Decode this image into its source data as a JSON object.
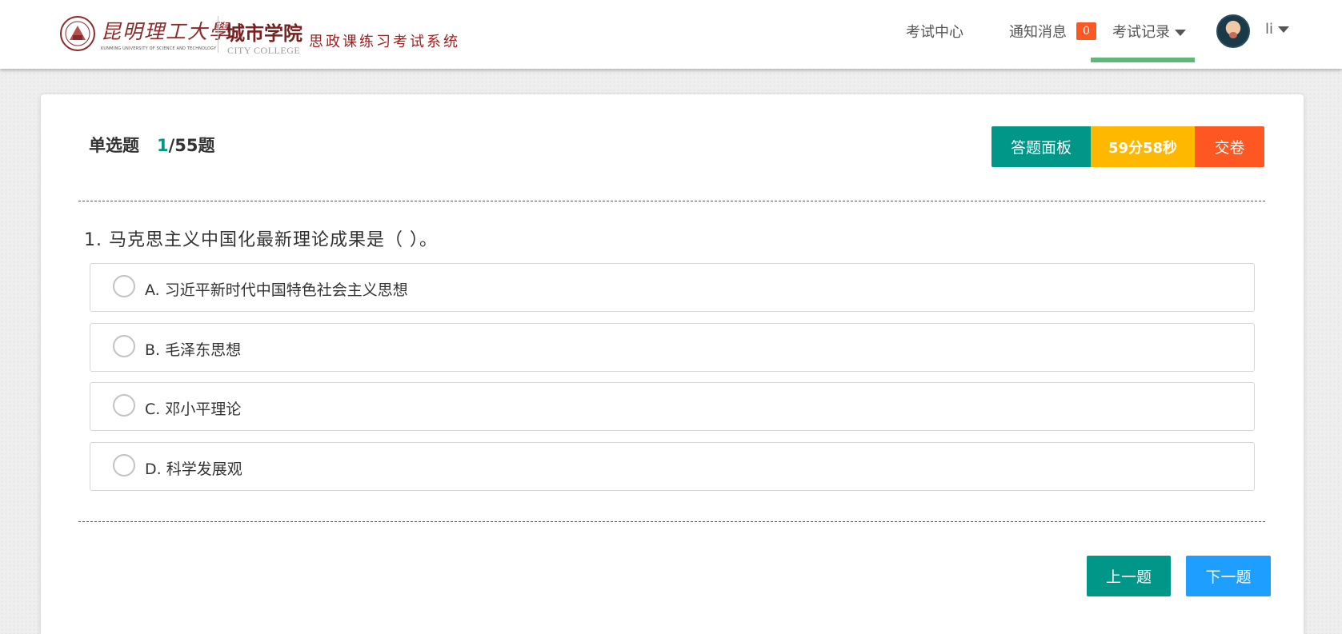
{
  "header": {
    "logo": {
      "university_name": "昆明理工大學",
      "university_en": "KUNMING UNIVERSITY OF SCIENCE AND TECHNOLOGY",
      "college_name": "城市学院",
      "college_en": "CITY COLLEGE",
      "system_name": "思政课练习考试系统"
    },
    "nav": {
      "exam_center": "考试中心",
      "notifications": "通知消息",
      "notification_count": "0",
      "exam_records": "考试记录"
    },
    "user": {
      "name": "li"
    }
  },
  "exam": {
    "question_type": "单选题",
    "current_index": "1",
    "total_label": "/55题",
    "buttons": {
      "answer_panel": "答题面板",
      "timer": "59分58秒",
      "submit": "交卷",
      "prev": "上一题",
      "next": "下一题"
    },
    "question": {
      "text": "1. 马克思主义中国化最新理论成果是（ ）。",
      "options": [
        {
          "label": "A. 习近平新时代中国特色社会主义思想"
        },
        {
          "label": "B. 毛泽东思想"
        },
        {
          "label": "C. 邓小平理论"
        },
        {
          "label": "D. 科学发展观"
        }
      ]
    }
  },
  "colors": {
    "primary": "#009688",
    "warning": "#ffb800",
    "danger": "#ff5722",
    "info": "#1e9fff",
    "nav_active": "#5fb878"
  }
}
